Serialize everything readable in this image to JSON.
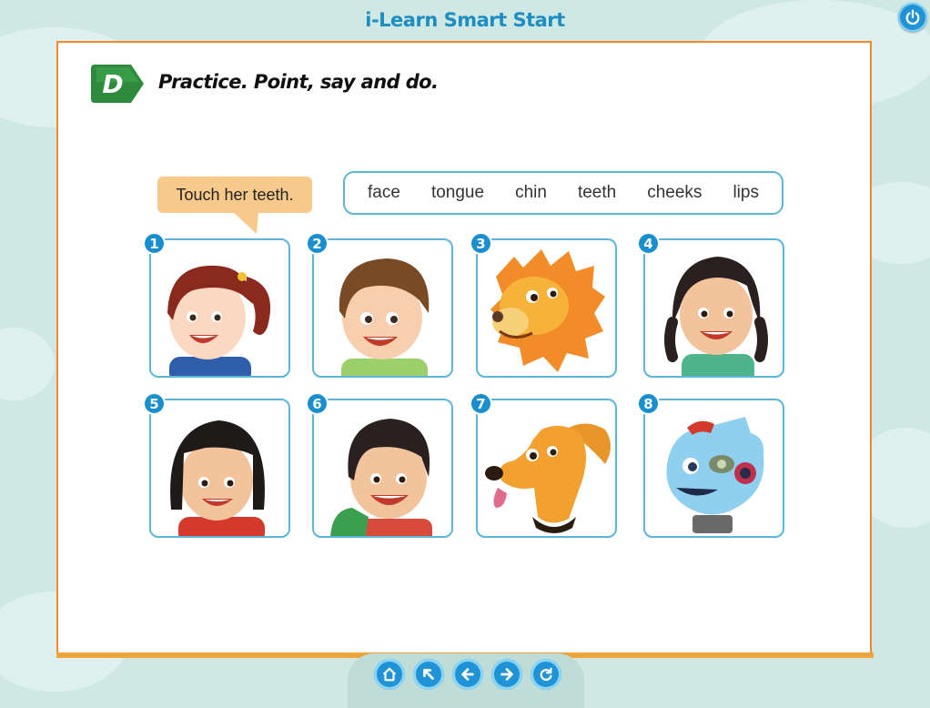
{
  "app": {
    "title": "i-Learn Smart Start"
  },
  "controls": {
    "power_icon": "power-icon"
  },
  "activity": {
    "letter": "D",
    "heading": "Practice. Point, say and do.",
    "speech": "Touch her teeth.",
    "words": [
      "face",
      "tongue",
      "chin",
      "teeth",
      "cheeks",
      "lips"
    ],
    "pictures": [
      {
        "number": "1",
        "subject": "girl-with-ponytail"
      },
      {
        "number": "2",
        "subject": "boy-brown-hair"
      },
      {
        "number": "3",
        "subject": "lion"
      },
      {
        "number": "4",
        "subject": "girl-with-braids"
      },
      {
        "number": "5",
        "subject": "girl-black-hair"
      },
      {
        "number": "6",
        "subject": "boy-with-backpack"
      },
      {
        "number": "7",
        "subject": "dog"
      },
      {
        "number": "8",
        "subject": "robot"
      }
    ]
  },
  "nav": {
    "buttons": [
      "home-icon",
      "arrow-up-left-icon",
      "arrow-left-icon",
      "arrow-right-icon",
      "refresh-icon"
    ]
  },
  "colors": {
    "accent": "#1f93d6",
    "page_border": "#f08a2c",
    "card_border": "#5ab7db",
    "badge": "#2e8b3d",
    "bubble": "#f7c98a"
  }
}
